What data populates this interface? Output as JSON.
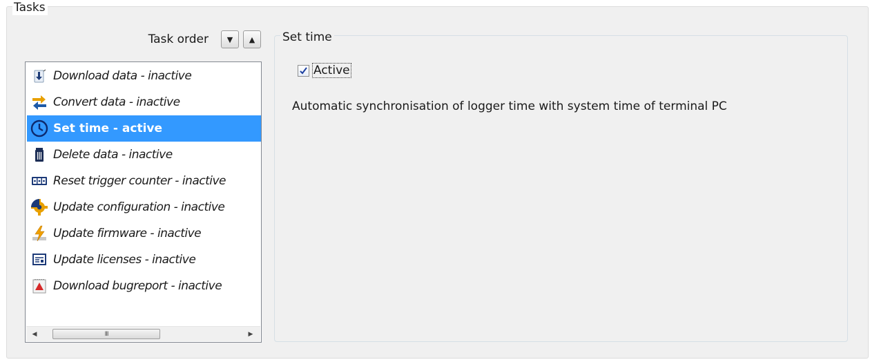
{
  "tasks_group": {
    "title": "Tasks"
  },
  "task_order": {
    "label": "Task order",
    "down_icon": "triangle-down-icon",
    "up_icon": "triangle-up-icon"
  },
  "task_list": {
    "items": [
      {
        "label": "Download data - inactive",
        "icon": "download-icon",
        "selected": false
      },
      {
        "label": "Convert data - inactive",
        "icon": "convert-arrows-icon",
        "selected": false
      },
      {
        "label": "Set time - active",
        "icon": "clock-icon",
        "selected": true
      },
      {
        "label": "Delete data - inactive",
        "icon": "trash-icon",
        "selected": false
      },
      {
        "label": "Reset trigger counter - inactive",
        "icon": "counter-icon",
        "selected": false
      },
      {
        "label": "Update configuration - inactive",
        "icon": "gear-icon",
        "selected": false
      },
      {
        "label": "Update firmware - inactive",
        "icon": "lightning-icon",
        "selected": false
      },
      {
        "label": "Update licenses - inactive",
        "icon": "license-icon",
        "selected": false
      },
      {
        "label": "Download bugreport - inactive",
        "icon": "bugreport-icon",
        "selected": false
      }
    ],
    "selection_color": "#3399ff",
    "scrollbar": {
      "thumb_grip": "III"
    }
  },
  "set_time": {
    "title": "Set time",
    "active_checkbox": {
      "label": "Active",
      "checked": true
    },
    "description": "Automatic synchronisation of logger time with system time of terminal PC"
  }
}
